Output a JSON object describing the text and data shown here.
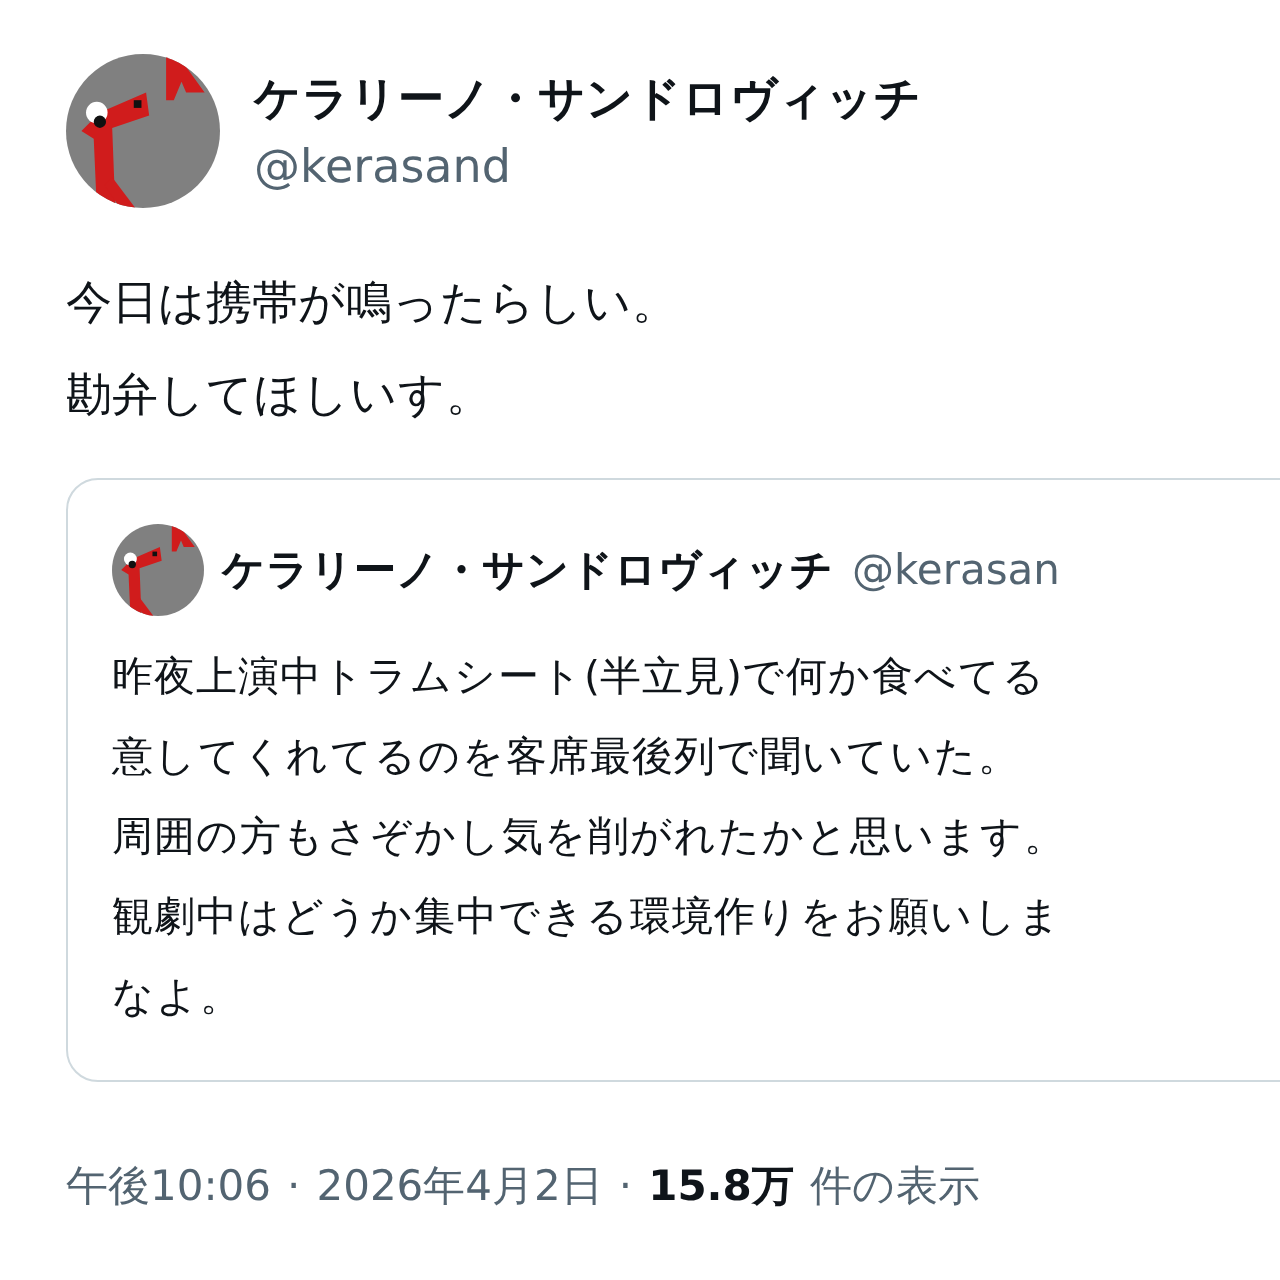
{
  "author": {
    "name": "ケラリーノ・サンドロヴィッチ",
    "handle": "@kerasand"
  },
  "text_lines": [
    "今日は携帯が鳴ったらしい。",
    "勘弁してほしいす。"
  ],
  "quoted": {
    "name": "ケラリーノ・サンドロヴィッチ",
    "handle": "@kerasan",
    "lines": [
      "昨夜上演中トラムシート(半立見)で何か食べてる",
      "意してくれてるのを客席最後列で聞いていた。",
      "周囲の方もさぞかし気を削がれたかと思います。",
      "観劇中はどうか集中できる環境作りをお願いしま",
      "なよ。"
    ]
  },
  "meta": {
    "time": "午後10:06",
    "separator": "·",
    "date": "2026年4月2日",
    "views_count": "15.8万",
    "views_label": "件の表示"
  }
}
